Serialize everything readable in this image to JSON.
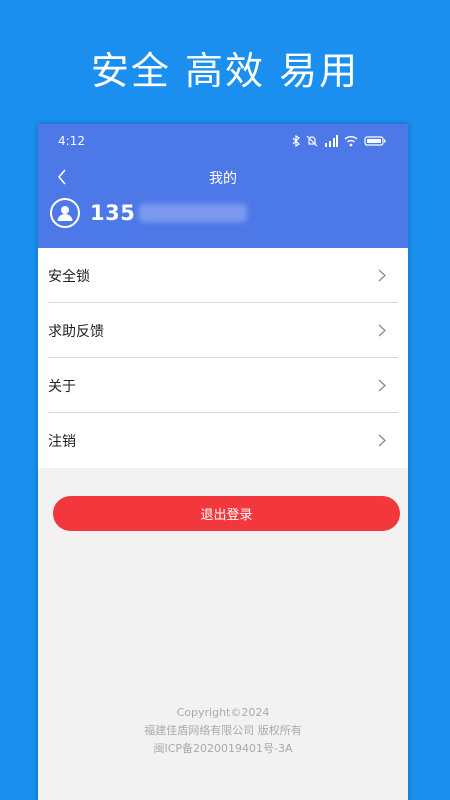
{
  "banner": {
    "headline": "安全 高效 易用"
  },
  "status_bar": {
    "time": "4:12",
    "icons": [
      "bluetooth-icon",
      "mute-icon",
      "signal-icon",
      "wifi-icon",
      "battery-icon"
    ]
  },
  "header": {
    "title": "我的",
    "phone_prefix": "135"
  },
  "menu": {
    "items": [
      {
        "label": "安全锁"
      },
      {
        "label": "求助反馈"
      },
      {
        "label": "关于"
      },
      {
        "label": "注销"
      }
    ]
  },
  "logout": {
    "label": "退出登录"
  },
  "footer": {
    "copyright": "Copyright©2024",
    "company": "福建佳盾网络有限公司 版权所有",
    "icp": "闽ICP备2020019401号-3A"
  },
  "colors": {
    "page_bg": "#1a8ff0",
    "header_bg": "#4d78e8",
    "logout_bg": "#f2383c"
  }
}
